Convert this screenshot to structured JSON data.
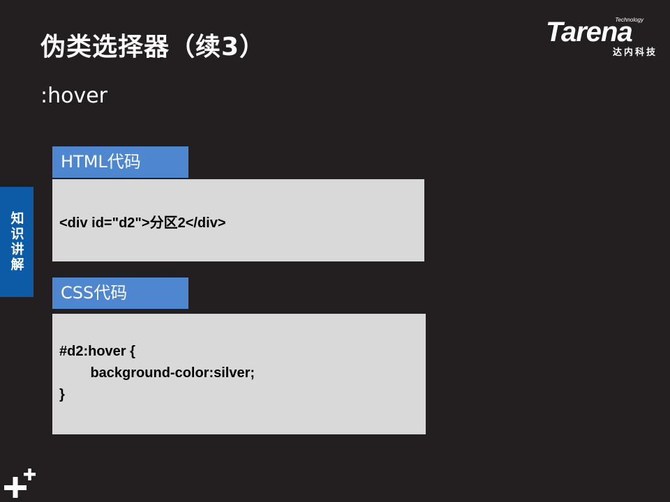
{
  "slide": {
    "title": "伪类选择器（续3）",
    "subtitle": ":hover"
  },
  "logo": {
    "technology": "Technology",
    "wordmark": "Tarena",
    "chinese": "达内科技"
  },
  "side_tab": {
    "label": "知识讲解"
  },
  "html_section": {
    "label": "HTML代码",
    "code": [
      "<div id=\"d2\">分区2</div>"
    ]
  },
  "css_section": {
    "label": "CSS代码",
    "code": [
      "#d2:hover {",
      "        background-color:silver;",
      "}"
    ]
  },
  "icons": {
    "corner": "plus-plus-icon"
  },
  "colors": {
    "background": "#231f20",
    "side_tab": "#0d5aa7",
    "section_label": "#4f86d0",
    "code_box": "#d9d9d9"
  }
}
